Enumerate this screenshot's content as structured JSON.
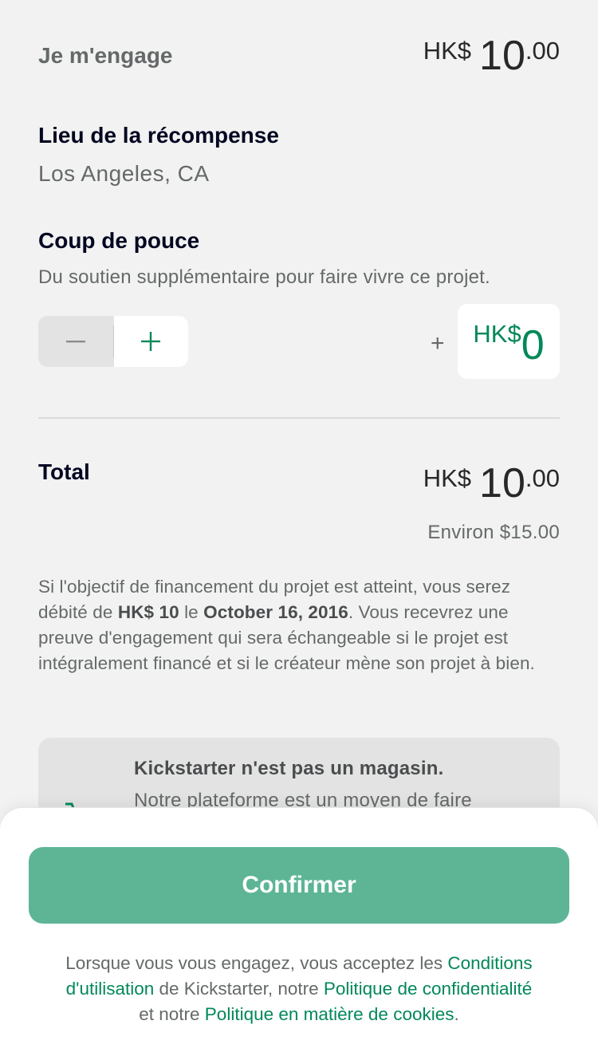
{
  "pledge": {
    "label": "Je m'engage",
    "currency": "HK$",
    "integer": "10",
    "decimal": ".00"
  },
  "reward_location": {
    "title": "Lieu de la récompense",
    "value": "Los Angeles, CA"
  },
  "bonus": {
    "title": "Coup de pouce",
    "subtitle": "Du soutien supplémentaire pour faire vivre ce projet.",
    "minus_symbol": "−",
    "plus_symbol": "+",
    "prefix_plus": "+",
    "currency": "HK$",
    "value": "0"
  },
  "total": {
    "label": "Total",
    "currency": "HK$",
    "integer": "10",
    "decimal": ".00",
    "approx": "Environ $15.00"
  },
  "disclaimer": {
    "part1": "Si l'objectif de financement du projet est atteint, vous serez débité de ",
    "amount": "HK$ 10",
    "part2": " le ",
    "date": "October 16, 2016",
    "part3": ". Vous recevrez une preuve d'engagement qui sera échangeable si le projet est intégralement financé et si le créateur mène son projet à bien."
  },
  "store_notice": {
    "title": "Kickstarter n'est pas un magasin.",
    "text": "Notre plateforme est un moyen de faire"
  },
  "confirm_button": "Confirmer",
  "legal": {
    "p1": "Lorsque vous vous engagez, vous acceptez les ",
    "terms": "Conditions d'utilisation",
    "p2": " de Kickstarter, notre ",
    "privacy": "Politique de confidentialité",
    "p3": " et notre ",
    "cookies": "Politique en matière de cookies",
    "p4": "."
  },
  "colors": {
    "accent": "#028858",
    "button": "#5db596",
    "background": "#f2f2f2"
  },
  "icons": {
    "cart": "shopping-cart-icon"
  }
}
